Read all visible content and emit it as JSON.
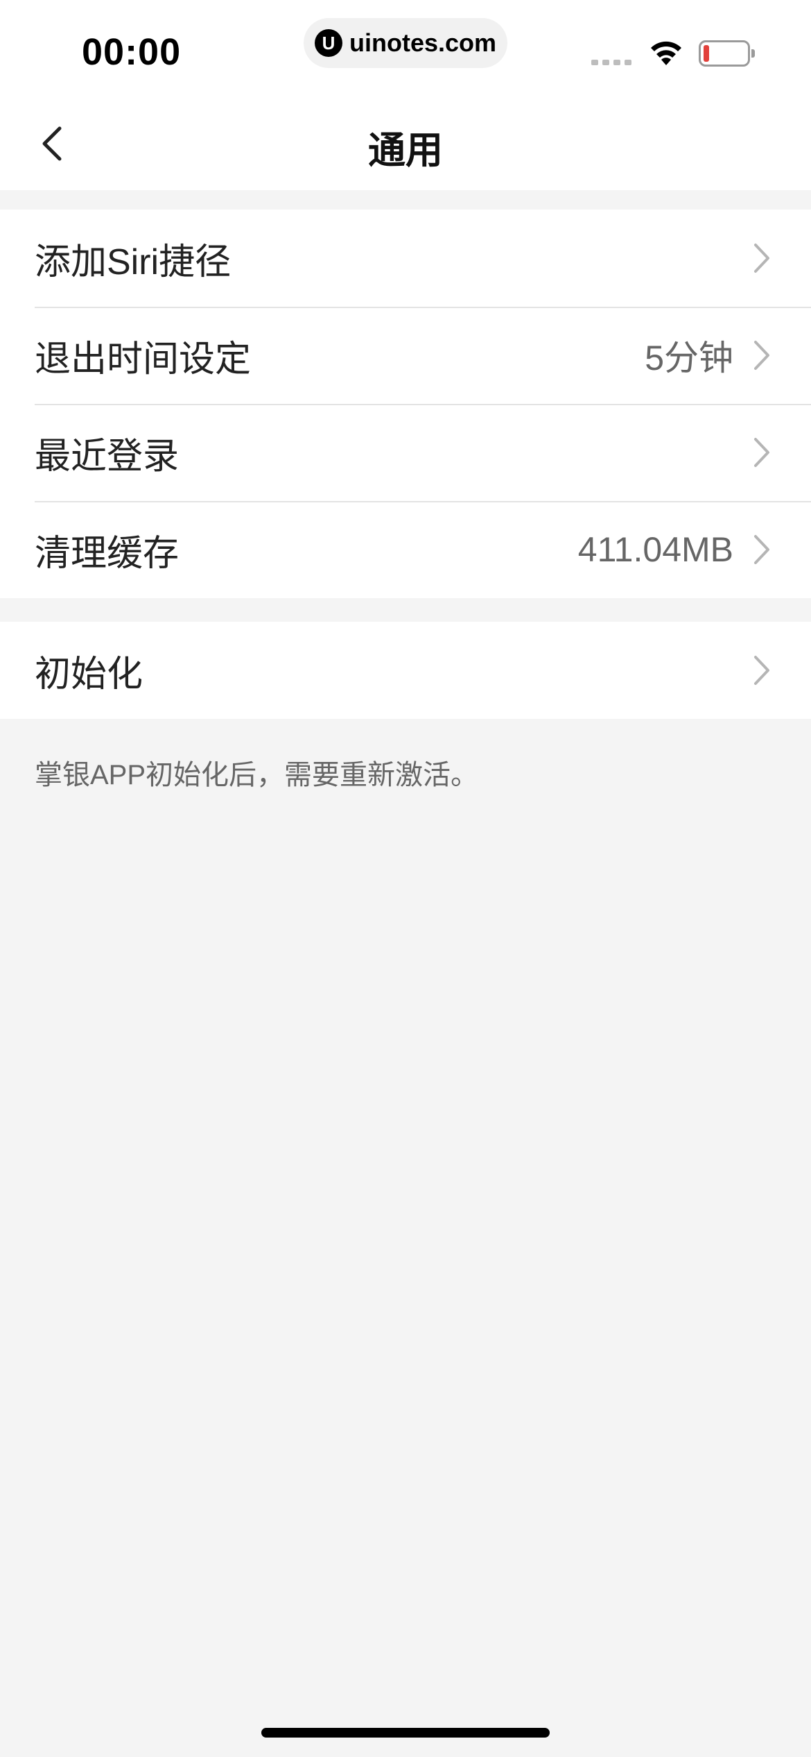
{
  "status_bar": {
    "time": "00:00",
    "url": "uinotes.com",
    "url_logo_letter": "U",
    "battery_color": "#e2413b"
  },
  "header": {
    "title": "通用",
    "back_icon": "chevron-left-icon"
  },
  "groups": [
    {
      "items": [
        {
          "label": "添加Siri捷径",
          "value": ""
        },
        {
          "label": "退出时间设定",
          "value": "5分钟"
        },
        {
          "label": "最近登录",
          "value": ""
        },
        {
          "label": "清理缓存",
          "value": "411.04MB"
        }
      ]
    },
    {
      "items": [
        {
          "label": "初始化",
          "value": ""
        }
      ]
    }
  ],
  "footnote": "掌银APP初始化后，需要重新激活。"
}
